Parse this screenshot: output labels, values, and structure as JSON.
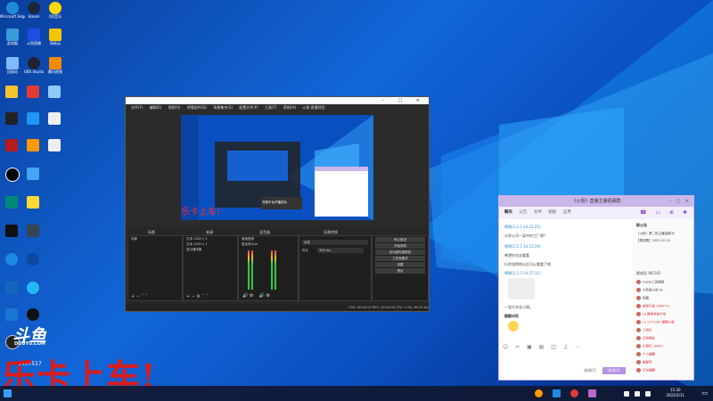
{
  "obs": {
    "menu": [
      "文件(F)",
      "编辑(E)",
      "视图(V)",
      "停靠部件(D)",
      "场景集合(S)",
      "配置文件(P)",
      "工具(T)",
      "帮助(H)",
      "斗鱼·直播伴侣"
    ],
    "panels": {
      "scenes": "场景",
      "sources": "来源",
      "mixer": "混音器",
      "transitions": "场景转换"
    },
    "scene_items": [
      "场景"
    ],
    "source_items": [
      "文本 (GDI+) 2",
      "文本 (GDI+) 1",
      "显示器采集"
    ],
    "mixer_labels": [
      "桌面音频",
      "麦克风/Aux"
    ],
    "controls": [
      "停止推流",
      "开始录制",
      "启动虚拟摄像机",
      "工作室模式",
      "设置",
      "退出"
    ],
    "status": "LIVE: 00:00:00   REC: 00:00:00   CPU: 0.3%, 60.00 fps",
    "fade": "淡化",
    "duration_label": "时长",
    "duration_value": "300 ms"
  },
  "overlay": {
    "brand": "斗鱼",
    "brand_sub": "DOUYU.COM",
    "room": "6497517",
    "big_text": "乐卡上车!",
    "small_text": "乐卡上车!",
    "inner_popup": "完美平台开播成功"
  },
  "chat": {
    "title": "《火炬》直播主播招募群",
    "tabs": [
      "聊天",
      "公告",
      "文件",
      "相册",
      "应用"
    ],
    "messages": [
      "啊啊(2.2.3 14:22:25)",
      "分享公司—面中的工厂吧?",
      "啊啊(2.2.3 14:23:29)",
      "希望你也去看看",
      "行你觉得吧以后可以看看了吧",
      "啊啊(2.2.3 14:27:11)",
      "一张大米去二楼。",
      "翻翻米粒"
    ],
    "side_header": "群公告",
    "side_lines": [
      "群公告",
      "《火炬》第二批主播招募中!",
      "【群招聘】2022-02-10"
    ],
    "member_header": "群成员 46/142",
    "members": [
      "Gusto三班雅韵",
      "大色鬼小鸡 Fe",
      "雨露",
      "刷帅们成 1664711",
      "Lk 撒嗅老板叶胡",
      "Ls 1171262 翻翻斗鱼",
      "三胡巴",
      "吕林攝影",
      "红攒红 26400",
      "个人翻翻",
      "都都养",
      "华东翻翻"
    ],
    "close_btn": "关闭(C)",
    "send_btn": "发送(S)",
    "colors": {
      "title_bar": "#c9b6ea",
      "accent": "#7a3fc4"
    }
  },
  "taskbar": {
    "time": "15:30",
    "date": "2022/2/11"
  },
  "desktop_icons": [
    {
      "label": "Microsoft Edge",
      "icon": "edge-icon",
      "color": "#1f8ad8"
    },
    {
      "label": "Steam",
      "icon": "steam-icon",
      "color": "#1b2838"
    },
    {
      "label": "QQ音乐",
      "icon": "qqmusic-icon",
      "color": "#ffd900"
    },
    {
      "label": "此电脑",
      "icon": "pc-icon",
      "color": "#3a9bdc"
    },
    {
      "label": "斗鱼直播",
      "icon": "douyu-icon",
      "color": "#1e4fe0"
    },
    {
      "label": "网易云",
      "icon": "netease-icon",
      "color": "#f5c400"
    },
    {
      "label": "回收站",
      "icon": "bin-icon",
      "color": "#7fb9ff"
    },
    {
      "label": "OBS Studio",
      "icon": "obs-icon",
      "color": "#223"
    },
    {
      "label": "腾讯视频",
      "icon": "video-icon",
      "color": "#f08c00"
    }
  ]
}
